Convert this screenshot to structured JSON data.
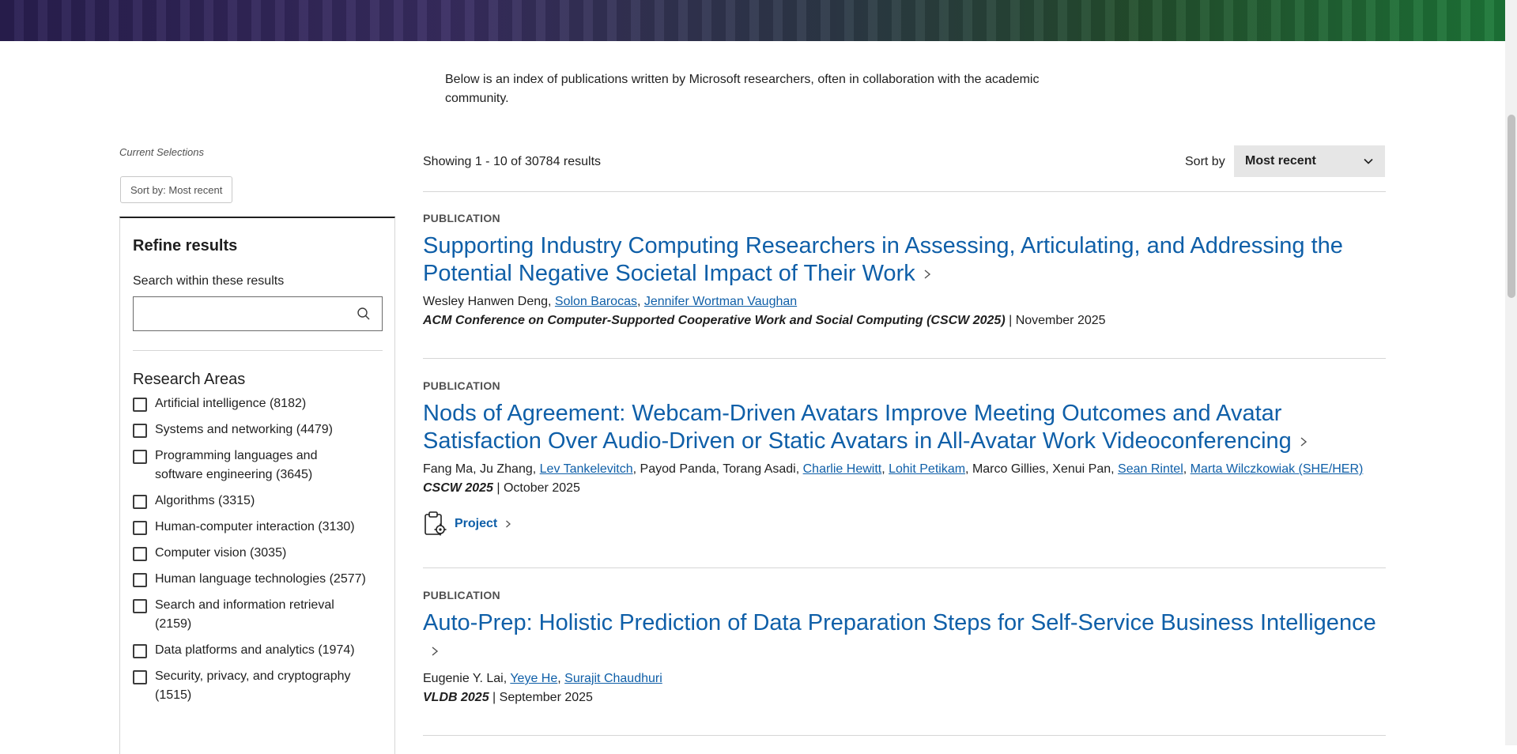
{
  "intro": {
    "line1": "Below is an index of publications written by Microsoft researchers, often in collaboration with the academic",
    "line2": "community."
  },
  "current_selections": {
    "label": "Current Selections",
    "chip": "Sort by: Most recent"
  },
  "refine": {
    "title": "Refine results",
    "search_label": "Search within these results",
    "search_value": "",
    "areas_title": "Research Areas",
    "areas": [
      {
        "label": "Artificial intelligence (8182)"
      },
      {
        "label": "Systems and networking (4479)"
      },
      {
        "label": "Programming languages and software engineering (3645)"
      },
      {
        "label": "Algorithms (3315)"
      },
      {
        "label": "Human-computer interaction (3130)"
      },
      {
        "label": "Computer vision (3035)"
      },
      {
        "label": "Human language technologies (2577)"
      },
      {
        "label": "Search and information retrieval (2159)"
      },
      {
        "label": "Data platforms and analytics (1974)"
      },
      {
        "label": "Security, privacy, and cryptography (1515)"
      }
    ]
  },
  "results": {
    "count": "Showing 1 - 10 of 30784 results",
    "sort_label": "Sort by",
    "sort_value": "Most recent"
  },
  "publications": [
    {
      "type": "PUBLICATION",
      "title": "Supporting Industry Computing Researchers in Assessing, Articulating, and Addressing the Potential Negative Societal Impact of Their Work",
      "authors": [
        {
          "name": "Wesley Hanwen Deng",
          "link": false
        },
        {
          "name": "Solon Barocas",
          "link": true
        },
        {
          "name": "Jennifer Wortman Vaughan",
          "link": true
        }
      ],
      "venue": "ACM Conference on Computer-Supported Cooperative Work and Social Computing (CSCW 2025)",
      "date": "November 2025"
    },
    {
      "type": "PUBLICATION",
      "title": "Nods of Agreement: Webcam-Driven Avatars Improve Meeting Outcomes and Avatar Satisfaction Over Audio-Driven or Static Avatars in All-Avatar Work Videoconferencing",
      "authors": [
        {
          "name": "Fang Ma",
          "link": false
        },
        {
          "name": "Ju Zhang",
          "link": false
        },
        {
          "name": "Lev Tankelevitch",
          "link": true
        },
        {
          "name": "Payod Panda",
          "link": false
        },
        {
          "name": "Torang Asadi",
          "link": false
        },
        {
          "name": "Charlie Hewitt",
          "link": true
        },
        {
          "name": "Lohit Petikam",
          "link": true
        },
        {
          "name": "Marco Gillies",
          "link": false
        },
        {
          "name": "Xenui Pan",
          "link": false
        },
        {
          "name": "Sean Rintel",
          "link": true
        },
        {
          "name": "Marta Wilczkowiak (SHE/HER)",
          "link": true
        }
      ],
      "venue": "CSCW 2025",
      "date": "October 2025",
      "project_label": "Project"
    },
    {
      "type": "PUBLICATION",
      "title": "Auto-Prep: Holistic Prediction of Data Preparation Steps for Self-Service Business Intelligence",
      "authors": [
        {
          "name": "Eugenie Y. Lai",
          "link": false
        },
        {
          "name": "Yeye He",
          "link": true
        },
        {
          "name": "Surajit Chaudhuri",
          "link": true
        }
      ],
      "venue": "VLDB 2025",
      "date": "September 2025"
    }
  ]
}
